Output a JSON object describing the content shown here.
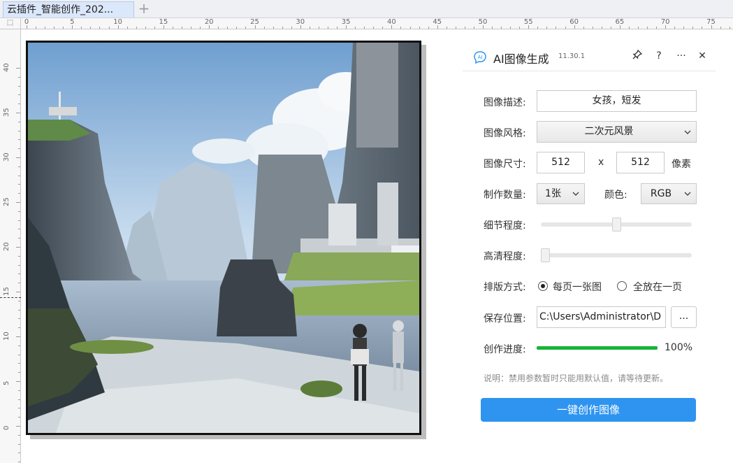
{
  "tab": {
    "title": "云插件_智能创作_202...",
    "add_symbol": "+"
  },
  "ruler": {
    "corner_symbol": "⬚",
    "h_labels": [
      "0",
      "5",
      "10",
      "15",
      "20",
      "25",
      "30",
      "35",
      "40",
      "45",
      "50",
      "55",
      "60",
      "65",
      "70",
      "75"
    ],
    "v_labels": [
      "40",
      "35",
      "30",
      "25",
      "20",
      "15",
      "10",
      "5",
      "0"
    ]
  },
  "canvas": {
    "image_alt": "anime style landscape with cliffs, water and two figures"
  },
  "panel": {
    "logo_text": "AI",
    "title": "AI图像生成",
    "version": "11.30.1",
    "header_icons": [
      "pin-icon",
      "help-icon",
      "more-icon",
      "close-icon"
    ],
    "help_symbol": "?",
    "more_symbol": "···",
    "close_symbol": "✕",
    "description": {
      "label": "图像描述:",
      "value": "女孩，短发"
    },
    "style": {
      "label": "图像风格:",
      "value": "二次元风景"
    },
    "size": {
      "label": "图像尺寸:",
      "width": "512",
      "sep": "x",
      "height": "512",
      "unit": "像素"
    },
    "count": {
      "label": "制作数量:",
      "value": "1张"
    },
    "color": {
      "label": "颜色:",
      "value": "RGB"
    },
    "detail": {
      "label": "细节程度:",
      "level": 0.5
    },
    "hd": {
      "label": "高清程度:",
      "level": 0.0
    },
    "layout": {
      "label": "排版方式:",
      "option1": "每页一张图",
      "option2": "全放在一页",
      "selected": "option1"
    },
    "save": {
      "label": "保存位置:",
      "path": "C:\\Users\\Administrator\\D",
      "browse": "..."
    },
    "progress": {
      "label": "创作进度:",
      "value": 100,
      "text": "100%"
    },
    "note": "说明：禁用参数暂时只能用默认值，请等待更新。",
    "generate_button": "一键创作图像",
    "colors": {
      "accent": "#2e94f0",
      "progress": "#18b33a"
    }
  }
}
